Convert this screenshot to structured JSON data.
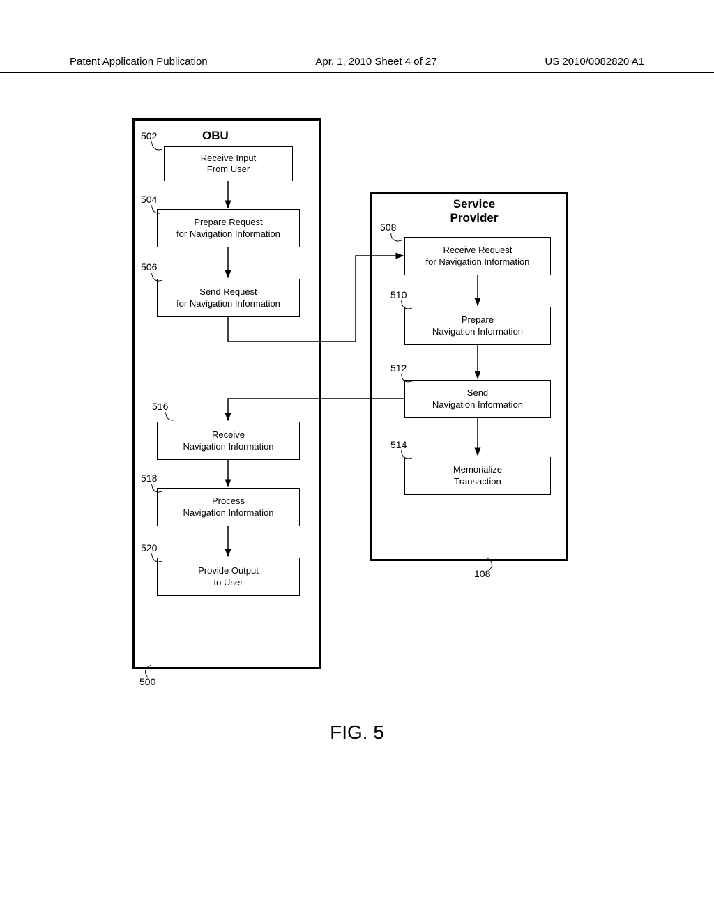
{
  "header": {
    "left": "Patent Application Publication",
    "mid": "Apr. 1, 2010  Sheet 4 of 27",
    "right": "US 2010/0082820 A1"
  },
  "obu": {
    "title": "OBU",
    "ref_bottom": "500",
    "steps": {
      "s502": {
        "ref": "502",
        "text": "Receive Input\nFrom User"
      },
      "s504": {
        "ref": "504",
        "text": "Prepare Request\nfor Navigation Information"
      },
      "s506": {
        "ref": "506",
        "text": "Send Request\nfor Navigation Information"
      },
      "s516": {
        "ref": "516",
        "text": "Receive\nNavigation Information"
      },
      "s518": {
        "ref": "518",
        "text": "Process\nNavigation Information"
      },
      "s520": {
        "ref": "520",
        "text": "Provide Output\nto User"
      }
    }
  },
  "sp": {
    "title": "Service\nProvider",
    "ref_bottom": "108",
    "steps": {
      "s508": {
        "ref": "508",
        "text": "Receive Request\nfor Navigation Information"
      },
      "s510": {
        "ref": "510",
        "text": "Prepare\nNavigation Information"
      },
      "s512": {
        "ref": "512",
        "text": "Send\nNavigation Information"
      },
      "s514": {
        "ref": "514",
        "text": "Memorialize\nTransaction"
      }
    }
  },
  "figure_label": "FIG. 5"
}
